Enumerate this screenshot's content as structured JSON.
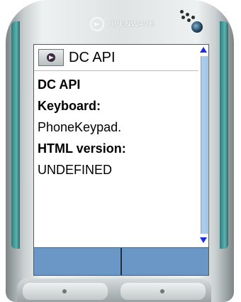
{
  "device": {
    "brand_logo_text": "OPENWAVE",
    "logo_icon": "openwave-swirl-icon"
  },
  "screen": {
    "title_icon": "page-icon",
    "title": "DC API",
    "lines": [
      {
        "text": "DC API",
        "bold": true
      },
      {
        "text": "Keyboard:",
        "bold": true
      },
      {
        "text": "PhoneKeypad.",
        "bold": false
      },
      {
        "text": "HTML version:",
        "bold": true
      },
      {
        "text": "UNDEFINED",
        "bold": false
      }
    ],
    "scroll_up_icon": "scroll-up-arrow-icon",
    "scroll_down_icon": "scroll-down-arrow-icon",
    "softkeys": {
      "left_label": "",
      "right_label": ""
    }
  },
  "colors": {
    "softkey_bar": "#6a97c6",
    "scroll_track": "#aacbea",
    "scroll_arrow": "#1a2ee0",
    "phone_trim": "#5cb2b0"
  }
}
